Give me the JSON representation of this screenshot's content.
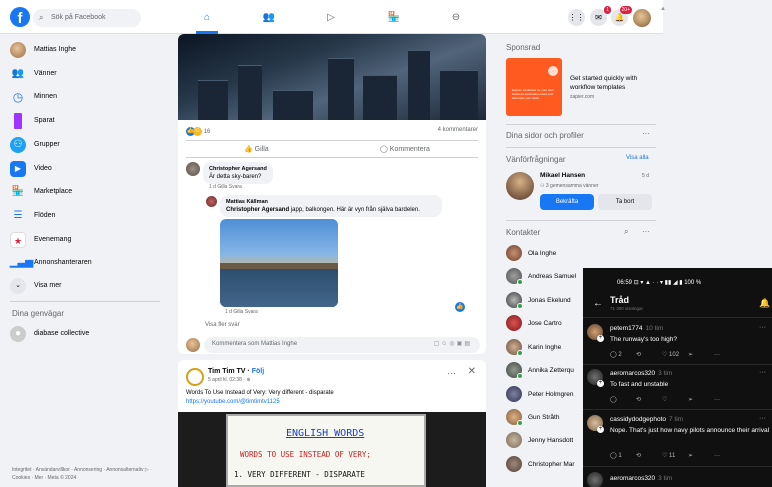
{
  "header": {
    "search_placeholder": "Sök på Facebook",
    "notif_messages": "1",
    "notif_alerts": "20+"
  },
  "sidebar": {
    "items": [
      {
        "label": "Mattias Inghe",
        "icon": "avatar",
        "color": "#c98a5a"
      },
      {
        "label": "Vänner",
        "icon": "friends-icon",
        "color": "#1877f2"
      },
      {
        "label": "Minnen",
        "icon": "memories-icon",
        "color": "#1877f2"
      },
      {
        "label": "Sparat",
        "icon": "saved-icon",
        "color": "#a033ff"
      },
      {
        "label": "Grupper",
        "icon": "groups-icon",
        "color": "#1877f2"
      },
      {
        "label": "Video",
        "icon": "video-icon",
        "color": "#1877f2"
      },
      {
        "label": "Marketplace",
        "icon": "marketplace-icon",
        "color": "#1877f2"
      },
      {
        "label": "Flöden",
        "icon": "feeds-icon",
        "color": "#1877f2"
      },
      {
        "label": "Evenemang",
        "icon": "events-icon",
        "color": "#e41e3f"
      },
      {
        "label": "Annonshanteraren",
        "icon": "ads-manager-icon",
        "color": "#1877f2"
      },
      {
        "label": "Visa mer",
        "icon": "chevron-down-icon",
        "color": "#e4e6eb"
      }
    ],
    "shortcuts_title": "Dina genvägar",
    "shortcut": "diabase collective",
    "footer": "Integritet · Användarvillkor · Annonsering · Annonsalternativ ▷ · Cookies · Mer · Meta © 2024"
  },
  "post1": {
    "reaction_count": "16",
    "comment_count": "4 kommentarer",
    "like_label": "Gilla",
    "comment_label": "Kommentera",
    "comment1": {
      "author": "Christopher Agersand",
      "text": "Är detta sky-baren?",
      "meta": "1 d   Gilla   Svara"
    },
    "reply1": {
      "author": "Mattias Källman",
      "mention": "Christopher Agersand",
      "text": " japp, balkongen. Här är vyn från själva bardelen.",
      "meta": "1 d   Gilla   Svara"
    },
    "view_more": "Visa fler svar",
    "write_placeholder": "Kommentera som Mattias Inghe"
  },
  "post2": {
    "author": "Tim Tim TV",
    "follow": "Följ",
    "date": "5 april kl. 02:38 · ⊕",
    "text": "Words To Use Instead of Very: Very different - disparate",
    "link": "https://youtube.com/@timtimtv1125",
    "wb_title": "ENGLISH WORDS",
    "wb_line1": "WORDS TO USE INSTEAD OF VERY;",
    "wb_line2": "1. VERY DIFFERENT - DISPARATE"
  },
  "right": {
    "sponsored_title": "Sponsrad",
    "ad_title": "Get started quickly with workflow templates",
    "ad_domain": "zapier.com",
    "ad_inner": "Explore workflows for your own business automation tasks and automate your tasks",
    "pages_title": "Dina sidor och profiler",
    "requests_title": "Vänförfrågningar",
    "see_all": "Visa alla",
    "request_name": "Mikael Hansen",
    "request_mutual": "3 gemensamma vänner",
    "request_time": "5 d",
    "confirm_label": "Bekräfta",
    "remove_label": "Ta bort",
    "contacts_title": "Kontakter",
    "contacts": [
      "Ola Inghe",
      "Andreas Samuel",
      "Jonas Ekelund",
      "Jose Cartro",
      "Karin Inghe",
      "Annika Zetterqu",
      "Peter Holmgren",
      "Gun Stråth",
      "Jenny Hansdott",
      "Christopher Mar"
    ]
  },
  "phone": {
    "status": "06:59 ⊡ ▾ ▲ ·   · ▾ ▮▮ ◢ ▮ 100 %",
    "title": "Tråd",
    "subtitle": "71 300 visningar",
    "posts": [
      {
        "user": "petem1774",
        "time": "10 tim",
        "text": "The runway's too high?",
        "replies": "2",
        "likes": "102"
      },
      {
        "user": "aeromarcos320",
        "time": "3 tim",
        "text": "To fast and unstable",
        "replies": "",
        "likes": ""
      },
      {
        "user": "cassidydodgephoto",
        "time": "7 tim",
        "text": "Nope. That's just how navy pilots announce their arrival",
        "replies": "1",
        "likes": "11"
      },
      {
        "user": "aeromarcos320",
        "time": "3 tim",
        "text": "",
        "replies": "",
        "likes": ""
      }
    ]
  }
}
